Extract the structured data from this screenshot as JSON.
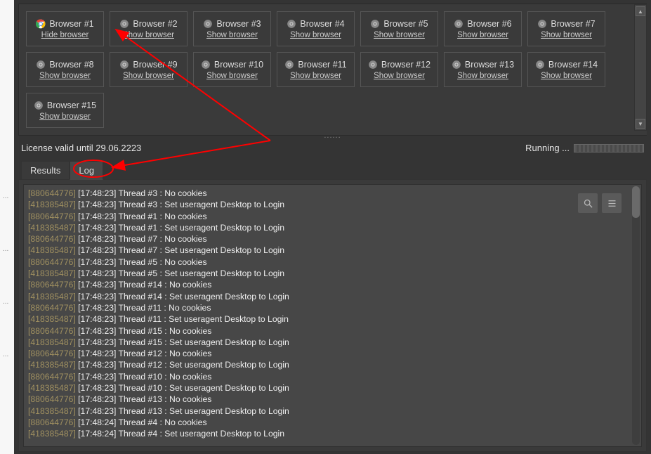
{
  "browsers": [
    {
      "label": "Browser #1",
      "action": "Hide browser",
      "active": true
    },
    {
      "label": "Browser #2",
      "action": "Show browser",
      "active": false
    },
    {
      "label": "Browser #3",
      "action": "Show browser",
      "active": false
    },
    {
      "label": "Browser #4",
      "action": "Show browser",
      "active": false
    },
    {
      "label": "Browser #5",
      "action": "Show browser",
      "active": false
    },
    {
      "label": "Browser #6",
      "action": "Show browser",
      "active": false
    },
    {
      "label": "Browser #7",
      "action": "Show browser",
      "active": false
    },
    {
      "label": "Browser #8",
      "action": "Show browser",
      "active": false
    },
    {
      "label": "Browser #9",
      "action": "Show browser",
      "active": false
    },
    {
      "label": "Browser #10",
      "action": "Show browser",
      "active": false
    },
    {
      "label": "Browser #11",
      "action": "Show browser",
      "active": false
    },
    {
      "label": "Browser #12",
      "action": "Show browser",
      "active": false
    },
    {
      "label": "Browser #13",
      "action": "Show browser",
      "active": false
    },
    {
      "label": "Browser #14",
      "action": "Show browser",
      "active": false
    },
    {
      "label": "Browser #15",
      "action": "Show browser",
      "active": false
    }
  ],
  "license_text": "License valid until 29.06.2223",
  "running_text": "Running ...",
  "tabs": {
    "results": "Results",
    "log": "Log",
    "active": "log"
  },
  "log": [
    {
      "id": "880644776",
      "ts": "17:48:23",
      "msg": "Thread #3 : No cookies"
    },
    {
      "id": "418385487",
      "ts": "17:48:23",
      "msg": "Thread #3 : Set useragent Desktop to Login"
    },
    {
      "id": "880644776",
      "ts": "17:48:23",
      "msg": "Thread #1 : No cookies"
    },
    {
      "id": "418385487",
      "ts": "17:48:23",
      "msg": "Thread #1 : Set useragent Desktop to Login"
    },
    {
      "id": "880644776",
      "ts": "17:48:23",
      "msg": "Thread #7 : No cookies"
    },
    {
      "id": "418385487",
      "ts": "17:48:23",
      "msg": "Thread #7 : Set useragent Desktop to Login"
    },
    {
      "id": "880644776",
      "ts": "17:48:23",
      "msg": "Thread #5 : No cookies"
    },
    {
      "id": "418385487",
      "ts": "17:48:23",
      "msg": "Thread #5 : Set useragent Desktop to Login"
    },
    {
      "id": "880644776",
      "ts": "17:48:23",
      "msg": "Thread #14 : No cookies"
    },
    {
      "id": "418385487",
      "ts": "17:48:23",
      "msg": "Thread #14 : Set useragent Desktop to Login"
    },
    {
      "id": "880644776",
      "ts": "17:48:23",
      "msg": "Thread #11 : No cookies"
    },
    {
      "id": "418385487",
      "ts": "17:48:23",
      "msg": "Thread #11 : Set useragent Desktop to Login"
    },
    {
      "id": "880644776",
      "ts": "17:48:23",
      "msg": "Thread #15 : No cookies"
    },
    {
      "id": "418385487",
      "ts": "17:48:23",
      "msg": "Thread #15 : Set useragent Desktop to Login"
    },
    {
      "id": "880644776",
      "ts": "17:48:23",
      "msg": "Thread #12 : No cookies"
    },
    {
      "id": "418385487",
      "ts": "17:48:23",
      "msg": "Thread #12 : Set useragent Desktop to Login"
    },
    {
      "id": "880644776",
      "ts": "17:48:23",
      "msg": "Thread #10 : No cookies"
    },
    {
      "id": "418385487",
      "ts": "17:48:23",
      "msg": "Thread #10 : Set useragent Desktop to Login"
    },
    {
      "id": "880644776",
      "ts": "17:48:23",
      "msg": "Thread #13 : No cookies"
    },
    {
      "id": "418385487",
      "ts": "17:48:23",
      "msg": "Thread #13 : Set useragent Desktop to Login"
    },
    {
      "id": "880644776",
      "ts": "17:48:24",
      "msg": "Thread #4 : No cookies"
    },
    {
      "id": "418385487",
      "ts": "17:48:24",
      "msg": "Thread #4 : Set useragent Desktop to Login"
    }
  ]
}
